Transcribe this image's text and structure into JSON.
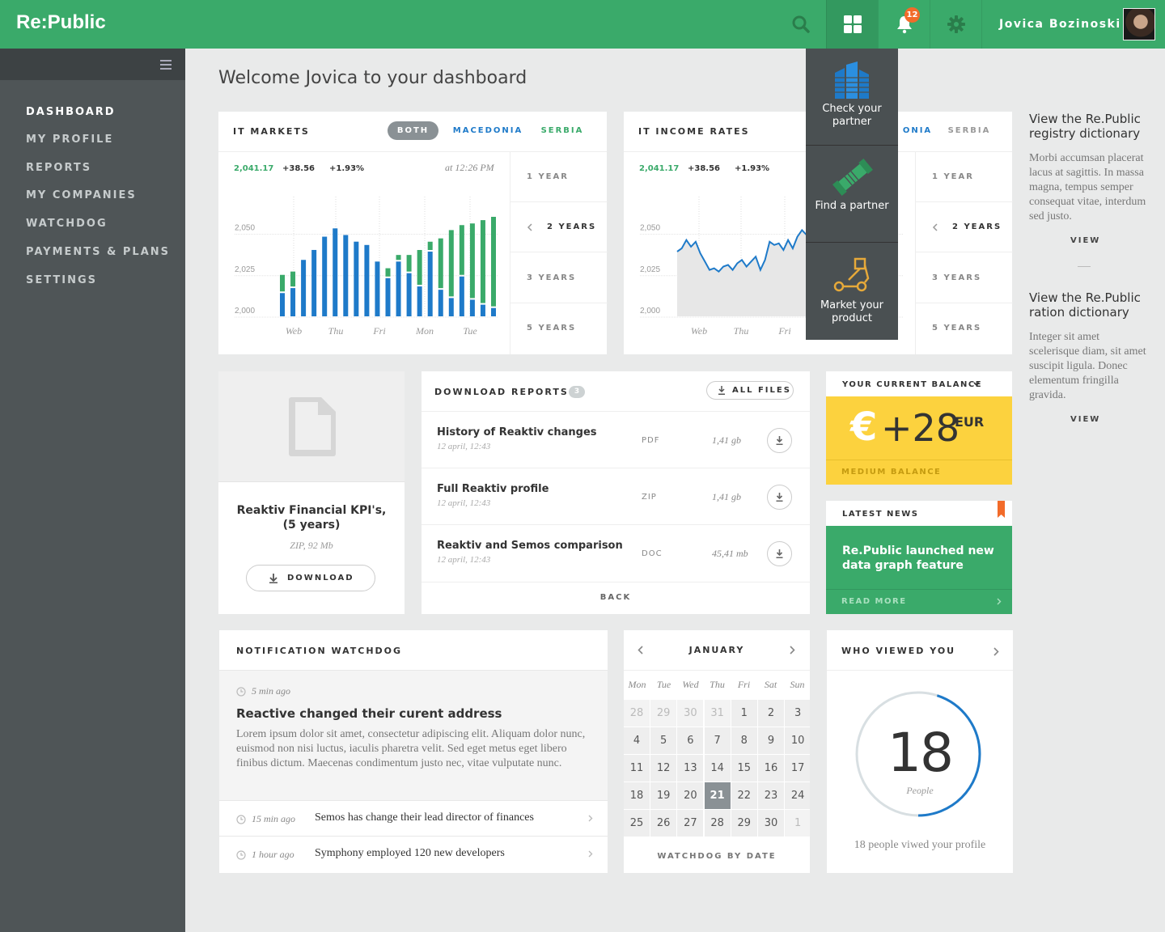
{
  "app": {
    "logo": "Re:Public",
    "user_name": "Jovica Bozinoski",
    "notifications_count": "12"
  },
  "sidebar": {
    "items": [
      {
        "label": "DASHBOARD",
        "active": true
      },
      {
        "label": "MY PROFILE"
      },
      {
        "label": "REPORTS"
      },
      {
        "label": "MY COMPANIES"
      },
      {
        "label": "WATCHDOG"
      },
      {
        "label": "PAYMENTS & PLANS"
      },
      {
        "label": "SETTINGS"
      }
    ]
  },
  "page_title": "Welcome Jovica to your dashboard",
  "dropdown": {
    "items": [
      {
        "label": "Check your partner",
        "icon": "buildings-icon"
      },
      {
        "label": "Find a partner",
        "icon": "handshake-icon"
      },
      {
        "label": "Market your product",
        "icon": "flow-icon"
      }
    ]
  },
  "it_markets": {
    "title": "IT MARKETS",
    "filters": [
      "BOTH",
      "MACEDONIA",
      "SERBIA"
    ],
    "value": "2,041.17",
    "change": "+38.56",
    "change_pct": "+1.93%",
    "time": "at 12:26 PM",
    "ranges": [
      "1 YEAR",
      "2 YEARS",
      "3 YEARS",
      "5 YEARS"
    ]
  },
  "it_income": {
    "title": "IT INCOME RATES",
    "filters": [
      "ONIA",
      "SERBIA"
    ],
    "value": "2,041.17",
    "change": "+38.56",
    "change_pct": "+1.93%",
    "ranges": [
      "1 YEAR",
      "2 YEARS",
      "3 YEARS",
      "5 YEARS"
    ]
  },
  "chart_data": [
    {
      "type": "bar",
      "title": "IT MARKETS",
      "categories": [
        "Web",
        "Thu",
        "Fri",
        "Mon",
        "Tue"
      ],
      "ylim": [
        2000,
        2060
      ],
      "yticks": [
        2000,
        2025,
        2050
      ],
      "series": [
        {
          "name": "",
          "color": "#1e7ac9",
          "values": [
            2015,
            2018,
            2035,
            2041,
            2049,
            2054,
            2050,
            2046,
            2044,
            2034,
            2024,
            2034,
            2027,
            2019,
            2040,
            2017,
            2012,
            2025,
            2011,
            2008,
            2006
          ]
        },
        {
          "name": "",
          "color": "#3aaa6a",
          "values": [
            2025,
            2027,
            2035,
            2041,
            2049,
            2054,
            2050,
            2046,
            2044,
            2034,
            2029,
            2037,
            2037,
            2040,
            2045,
            2047,
            2052,
            2055,
            2056,
            2058,
            2060
          ]
        }
      ]
    },
    {
      "type": "area",
      "title": "IT INCOME RATES",
      "categories": [
        "Web",
        "Thu",
        "Fri"
      ],
      "ylim": [
        2000,
        2060
      ],
      "yticks": [
        2000,
        2025,
        2050
      ],
      "series": [
        {
          "name": "",
          "color": "#1e7ac9",
          "values": [
            2039,
            2041,
            2046,
            2042,
            2045,
            2038,
            2033,
            2028,
            2029,
            2027,
            2030,
            2031,
            2028,
            2032,
            2034,
            2030,
            2033,
            2036,
            2028,
            2034,
            2045,
            2043,
            2044,
            2040,
            2046,
            2041,
            2048,
            2052,
            2049
          ]
        }
      ]
    }
  ],
  "kpi_file": {
    "title_line1": "Reaktiv Financial KPI's,",
    "title_line2": "(5 years)",
    "meta": "ZIP, 92 Mb",
    "button": "DOWNLOAD"
  },
  "downloads": {
    "title": "DOWNLOAD REPORTS",
    "count": "3",
    "all_files": "ALL FILES",
    "back": "BACK",
    "rows": [
      {
        "name": "History of Reaktiv changes",
        "date": "12 april, 12:43",
        "type": "PDF",
        "size": "1,41 gb"
      },
      {
        "name": "Full Reaktiv profile",
        "date": "12 april, 12:43",
        "type": "ZIP",
        "size": "1,41 gb"
      },
      {
        "name": "Reaktiv and Semos comparison",
        "date": "12 april, 12:43",
        "type": "DOC",
        "size": "45,41 mb"
      }
    ]
  },
  "balance": {
    "label": "YOUR CURRENT BALANCE",
    "symbol": "€",
    "amount": "+28",
    "currency": "EUR",
    "status": "MEDIUM BALANCE",
    "color": "#fcd23e"
  },
  "news": {
    "label": "LATEST NEWS",
    "headline": "Re.Public launched new data graph feature",
    "read_more": "READ MORE"
  },
  "right_column": [
    {
      "title": "View the Re.Public registry dictionary",
      "body": "Morbi accumsan placerat lacus at sagittis. In massa magna, tempus semper consequat vitae, interdum sed justo.",
      "link": "VIEW"
    },
    {
      "title": "View the Re.Public ration dictionary",
      "body": "Integer sit amet scelerisque diam, sit amet suscipit ligula. Donec elementum fringilla gravida.",
      "link": "VIEW"
    }
  ],
  "watchdog": {
    "title": "NOTIFICATION WATCHDOG",
    "featured": {
      "time": "5 min ago",
      "headline": "Reactive changed their curent address",
      "body": "Lorem ipsum dolor sit amet, consectetur adipiscing elit. Aliquam dolor nunc, euismod non nisi luctus, iaculis pharetra velit. Sed eget metus eget libero finibus dictum. Maecenas condimentum justo nec, vitae vulputate nunc."
    },
    "items": [
      {
        "time": "15 min ago",
        "text": "Semos has change their lead director of finances"
      },
      {
        "time": "1 hour ago",
        "text": "Symphony employed 120 new developers"
      }
    ]
  },
  "calendar": {
    "month": "JANUARY",
    "days": [
      "Mon",
      "Tue",
      "Wed",
      "Thu",
      "Fri",
      "Sat",
      "Sun"
    ],
    "dates": [
      "28",
      "29",
      "30",
      "31",
      "1",
      "2",
      "3",
      "4",
      "5",
      "6",
      "7",
      "8",
      "9",
      "10",
      "11",
      "12",
      "13",
      "14",
      "15",
      "16",
      "17",
      "18",
      "19",
      "20",
      "21",
      "22",
      "23",
      "24",
      "25",
      "26",
      "27",
      "28",
      "29",
      "30",
      "1"
    ],
    "selected": "21",
    "footer": "WATCHDOG BY DATE"
  },
  "viewers": {
    "title": "WHO VIEWED YOU",
    "count": "18",
    "unit": "People",
    "caption": "18 people viwed your profile",
    "progress": 0.45
  }
}
